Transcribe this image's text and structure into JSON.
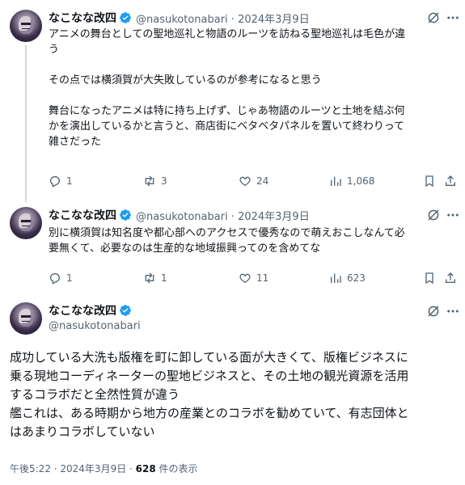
{
  "author": {
    "name": "なこなな改四",
    "handle": "@nasukotonabari"
  },
  "tweets": [
    {
      "handle_date": "@nasukotonabari · 2024年3月9日",
      "lines": [
        "アニメの舞台としての聖地巡礼と物語のルーツを訪ねる聖地巡礼は毛色が違",
        "う",
        "",
        "その点では横須賀が大失敗しているのが参考になると思う",
        "",
        "舞台になったアニメは特に持ち上げず、じゃあ物語のルーツと土地を結ぶ何",
        "かを演出しているかと言うと、商店街にベタベタパネルを置いて終わりって",
        "雑さだった"
      ],
      "replies": "1",
      "reposts": "3",
      "likes": "24",
      "views": "1,068"
    },
    {
      "handle_date": "@nasukotonabari · 2024年3月9日",
      "lines": [
        "別に横須賀は知名度や都心部へのアクセスで優秀なので萌えおこしなんて必",
        "要無くて、必要なのは生産的な地域振興ってのを含めてな"
      ],
      "replies": "1",
      "reposts": "1",
      "likes": "11",
      "views": "623"
    }
  ],
  "main": {
    "lines": [
      "成功している大洗も版権を町に卸している面が大きくて、版権ビジネスに",
      "乗る現地コーディネーターの聖地ビジネスと、その土地の観光資源を活用",
      "するコラボだと全然性質が違う",
      "艦これは、ある時期から地方の産業とのコラボを勧めていて、有志団体と",
      "はあまりコラボしていない"
    ],
    "time_date": "午後5:22 · 2024年3月9日 · ",
    "views_count": "628",
    "views_label": " 件の表示"
  },
  "icons": {
    "verified": "verified-badge-icon",
    "grok": "grok-icon",
    "more": "more-icon",
    "reply": "reply-icon",
    "repost": "repost-icon",
    "like": "like-icon",
    "views": "views-icon",
    "bookmark": "bookmark-icon",
    "share": "share-icon"
  },
  "colors": {
    "verified": "#1d9bf0",
    "muted": "#536471",
    "text": "#0f1419",
    "thread_line": "#cfd9de"
  }
}
